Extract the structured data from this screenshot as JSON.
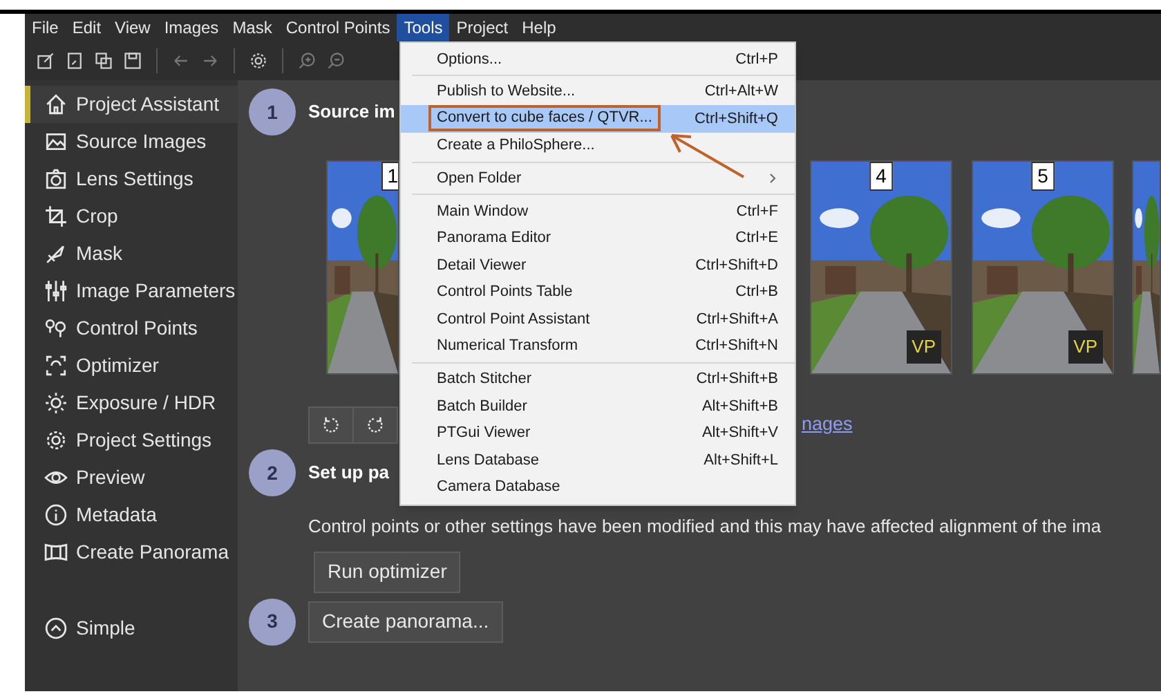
{
  "menubar": [
    {
      "label": "File",
      "selected": false
    },
    {
      "label": "Edit",
      "selected": false
    },
    {
      "label": "View",
      "selected": false
    },
    {
      "label": "Images",
      "selected": false
    },
    {
      "label": "Mask",
      "selected": false
    },
    {
      "label": "Control Points",
      "selected": false
    },
    {
      "label": "Tools",
      "selected": true
    },
    {
      "label": "Project",
      "selected": false
    },
    {
      "label": "Help",
      "selected": false
    }
  ],
  "sidebar": {
    "items": [
      {
        "label": "Project Assistant",
        "selected": true
      },
      {
        "label": "Source Images",
        "selected": false
      },
      {
        "label": "Lens Settings",
        "selected": false
      },
      {
        "label": "Crop",
        "selected": false
      },
      {
        "label": "Mask",
        "selected": false
      },
      {
        "label": "Image Parameters",
        "selected": false
      },
      {
        "label": "Control Points",
        "selected": false
      },
      {
        "label": "Optimizer",
        "selected": false
      },
      {
        "label": "Exposure / HDR",
        "selected": false
      },
      {
        "label": "Project Settings",
        "selected": false
      },
      {
        "label": "Preview",
        "selected": false
      },
      {
        "label": "Metadata",
        "selected": false
      },
      {
        "label": "Create Panorama",
        "selected": false
      }
    ],
    "mode_button": "Simple"
  },
  "steps": [
    {
      "number": "1",
      "title": "Source im",
      "thumbnails": [
        {
          "label": "1",
          "kind": "picture"
        },
        {
          "label": "4",
          "badge": "VP",
          "kind": "picture"
        },
        {
          "label": "5",
          "badge": "VP",
          "kind": "picture"
        },
        {
          "kind": "picture"
        }
      ],
      "link": "nages"
    },
    {
      "number": "2",
      "title": "Set up pa",
      "message": "Control points or other settings have been modified and this may have affected alignment of the ima",
      "button": "Run optimizer"
    },
    {
      "number": "3",
      "button": "Create panorama..."
    }
  ],
  "tools_menu": {
    "items": [
      {
        "label": "Options...",
        "shortcut": "Ctrl+P",
        "selected": false
      },
      {
        "kind": "separator"
      },
      {
        "label": "Publish to Website...",
        "shortcut": "Ctrl+Alt+W",
        "selected": false
      },
      {
        "label": "Convert to cube faces / QTVR...",
        "shortcut": "Ctrl+Shift+Q",
        "selected": true,
        "annotated": true
      },
      {
        "label": "Create a PhiloSphere...",
        "selected": false
      },
      {
        "kind": "separator"
      },
      {
        "label": "Open Folder",
        "submenu": true,
        "selected": false
      },
      {
        "kind": "separator"
      },
      {
        "label": "Main Window",
        "shortcut": "Ctrl+F",
        "selected": false
      },
      {
        "label": "Panorama Editor",
        "shortcut": "Ctrl+E",
        "selected": false
      },
      {
        "label": "Detail Viewer",
        "shortcut": "Ctrl+Shift+D",
        "selected": false
      },
      {
        "label": "Control Points Table",
        "shortcut": "Ctrl+B",
        "selected": false
      },
      {
        "label": "Control Point Assistant",
        "shortcut": "Ctrl+Shift+A",
        "selected": false
      },
      {
        "label": "Numerical Transform",
        "shortcut": "Ctrl+Shift+N",
        "selected": false
      },
      {
        "kind": "separator"
      },
      {
        "label": "Batch Stitcher",
        "shortcut": "Ctrl+Shift+B",
        "selected": false
      },
      {
        "label": "Batch Builder",
        "shortcut": "Alt+Shift+B",
        "selected": false
      },
      {
        "label": "PTGui Viewer",
        "shortcut": "Alt+Shift+V",
        "selected": false
      },
      {
        "label": "Lens Database",
        "shortcut": "Alt+Shift+L",
        "selected": false
      },
      {
        "label": "Camera Database",
        "selected": false
      }
    ]
  }
}
